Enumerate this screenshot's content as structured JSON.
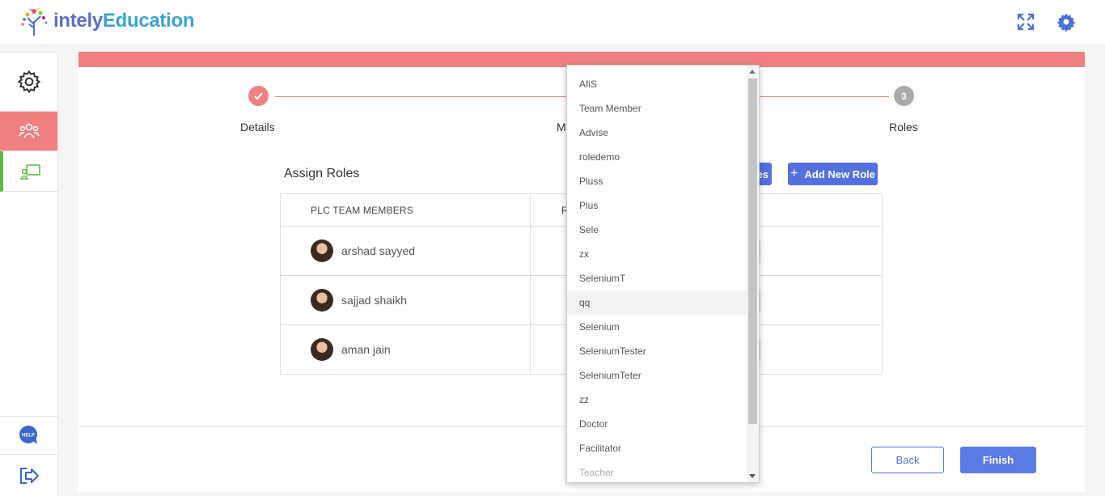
{
  "header": {
    "logo_text_part1": "intely",
    "logo_text_part2": "Education"
  },
  "sidebar": {
    "items": [
      {
        "icon": "gear-icon"
      },
      {
        "icon": "team-icon",
        "active": true
      },
      {
        "icon": "presentation-icon"
      }
    ],
    "help_label": "HELP"
  },
  "wizard": {
    "steps": [
      {
        "label": "Details",
        "state": "done"
      },
      {
        "label": "M",
        "state": "current"
      },
      {
        "label": "Roles",
        "number": "3",
        "state": "pending"
      }
    ]
  },
  "assign": {
    "title": "Assign Roles",
    "hidden_button_tail": "es",
    "add_role_label": "Add New Role",
    "col_members": "PLC TEAM MEMBERS",
    "col_roles": "R",
    "members": [
      {
        "name": "arshad sayyed"
      },
      {
        "name": "sajjad shaikh"
      },
      {
        "name": "aman jain"
      }
    ]
  },
  "footer": {
    "back_label": "Back",
    "finish_label": "Finish"
  },
  "dropdown": {
    "options": [
      "AfiS",
      "Team Member",
      "Advise",
      "roledemo",
      "Pluss",
      "Plus",
      "Sele",
      "zx",
      "SeleniumT",
      "qq",
      "Selenium",
      "SeleniumTester",
      "SeleniumTeter",
      "zz",
      "Doctor",
      "Facilitator",
      "Teacher"
    ],
    "hovered": "qq"
  },
  "colors": {
    "accent_red": "#f08080",
    "primary_blue": "#5470e0",
    "green_marker": "#5bbb3f"
  }
}
